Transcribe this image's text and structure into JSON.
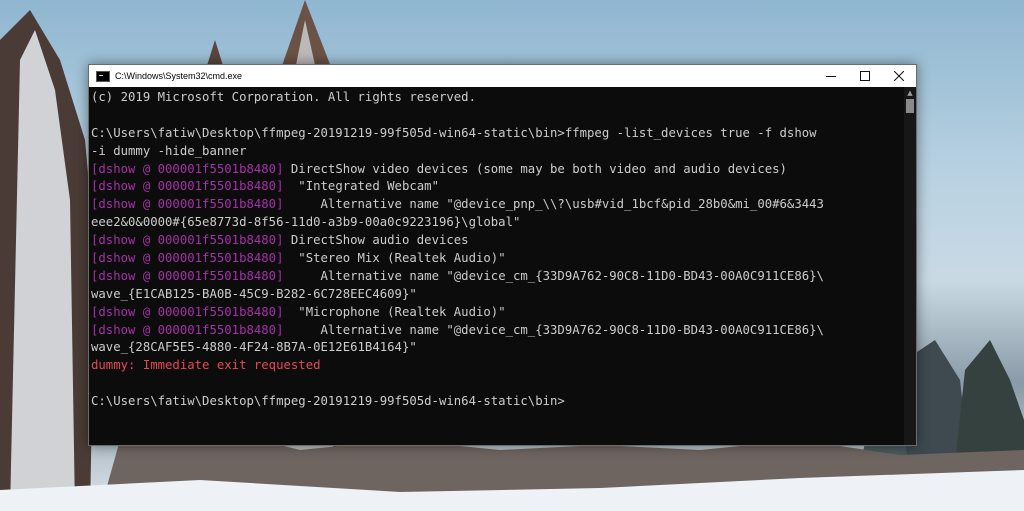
{
  "window": {
    "title": "C:\\Windows\\System32\\cmd.exe",
    "controls": {
      "minimize": "—",
      "maximize": "☐",
      "close": "✕"
    }
  },
  "colors": {
    "console_bg": "#0c0c0c",
    "console_text": "#cccccc",
    "prefix_magenta": "#a630a8",
    "error_red": "#e74856"
  },
  "console": {
    "lines": [
      {
        "text": "(c) 2019 Microsoft Corporation. All rights reserved."
      },
      {
        "text": ""
      },
      {
        "text": "C:\\Users\\fatiw\\Desktop\\ffmpeg-20191219-99f505d-win64-static\\bin>ffmpeg -list_devices true -f dshow"
      },
      {
        "text": "-i dummy -hide_banner"
      },
      {
        "prefix": "[dshow @ 000001f5501b8480]",
        "text": " DirectShow video devices (some may be both video and audio devices)"
      },
      {
        "prefix": "[dshow @ 000001f5501b8480]",
        "text": "  \"Integrated Webcam\""
      },
      {
        "prefix": "[dshow @ 000001f5501b8480]",
        "text": "     Alternative name \"@device_pnp_\\\\?\\usb#vid_1bcf&pid_28b0&mi_00#6&3443"
      },
      {
        "text": "eee2&0&0000#{65e8773d-8f56-11d0-a3b9-00a0c9223196}\\global\""
      },
      {
        "prefix": "[dshow @ 000001f5501b8480]",
        "text": " DirectShow audio devices"
      },
      {
        "prefix": "[dshow @ 000001f5501b8480]",
        "text": "  \"Stereo Mix (Realtek Audio)\""
      },
      {
        "prefix": "[dshow @ 000001f5501b8480]",
        "text": "     Alternative name \"@device_cm_{33D9A762-90C8-11D0-BD43-00A0C911CE86}\\"
      },
      {
        "text": "wave_{E1CAB125-BA0B-45C9-B282-6C728EEC4609}\""
      },
      {
        "prefix": "[dshow @ 000001f5501b8480]",
        "text": "  \"Microphone (Realtek Audio)\""
      },
      {
        "prefix": "[dshow @ 000001f5501b8480]",
        "text": "     Alternative name \"@device_cm_{33D9A762-90C8-11D0-BD43-00A0C911CE86}\\"
      },
      {
        "text": "wave_{28CAF5E5-4880-4F24-8B7A-0E12E61B4164}\""
      },
      {
        "error": true,
        "text": "dummy: Immediate exit requested"
      },
      {
        "text": ""
      },
      {
        "text": "C:\\Users\\fatiw\\Desktop\\ffmpeg-20191219-99f505d-win64-static\\bin>"
      }
    ]
  }
}
